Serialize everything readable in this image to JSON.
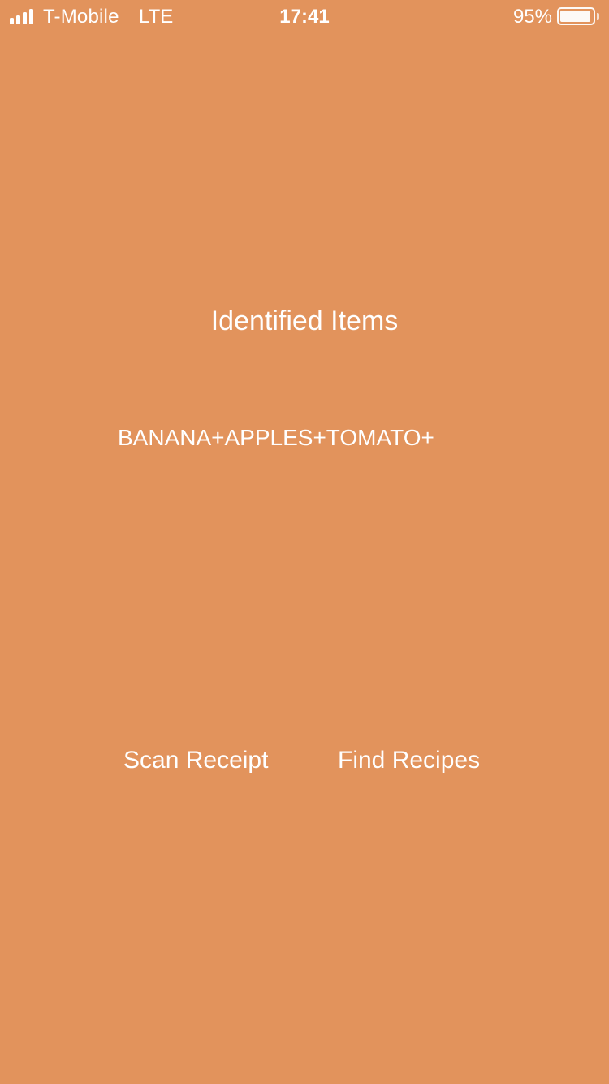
{
  "status_bar": {
    "carrier": "T-Mobile",
    "network": "LTE",
    "time": "17:41",
    "battery_percent": "95%",
    "battery_level": 0.95,
    "signal_bars": 4
  },
  "main": {
    "title": "Identified Items",
    "items_text": "BANANA+APPLES+TOMATO+"
  },
  "buttons": {
    "scan_label": "Scan Receipt",
    "find_label": "Find Recipes"
  },
  "colors": {
    "background": "#E2935C",
    "text": "#FFFFFF"
  }
}
